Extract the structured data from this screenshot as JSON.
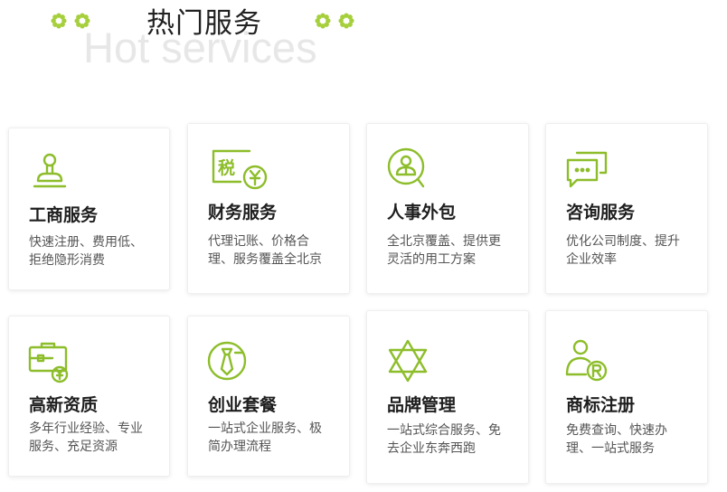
{
  "header": {
    "title": "热门服务",
    "subtitle": "Hot services"
  },
  "accent_color": "#8dbd2a",
  "services": [
    {
      "name": "工商服务",
      "desc": "快速注册、费用低、拒绝隐形消费",
      "icon": "stamp-icon"
    },
    {
      "name": "财务服务",
      "desc": "代理记账、价格合理、服务覆盖全北京",
      "icon": "tax-icon"
    },
    {
      "name": "人事外包",
      "desc": "全北京覆盖、提供更灵活的用工方案",
      "icon": "person-search-icon"
    },
    {
      "name": "咨询服务",
      "desc": "优化公司制度、提升企业效率",
      "icon": "chat-icon"
    },
    {
      "name": "高新资质",
      "desc": "多年行业经验、专业服务、充足资源",
      "icon": "briefcase-icon"
    },
    {
      "name": "创业套餐",
      "desc": "一站式企业服务、极简办理流程",
      "icon": "tie-icon"
    },
    {
      "name": "品牌管理",
      "desc": "一站式综合服务、免去企业东奔西跑",
      "icon": "star-icon"
    },
    {
      "name": "商标注册",
      "desc": "免费查询、快速办理、一站式服务",
      "icon": "trademark-icon"
    }
  ]
}
